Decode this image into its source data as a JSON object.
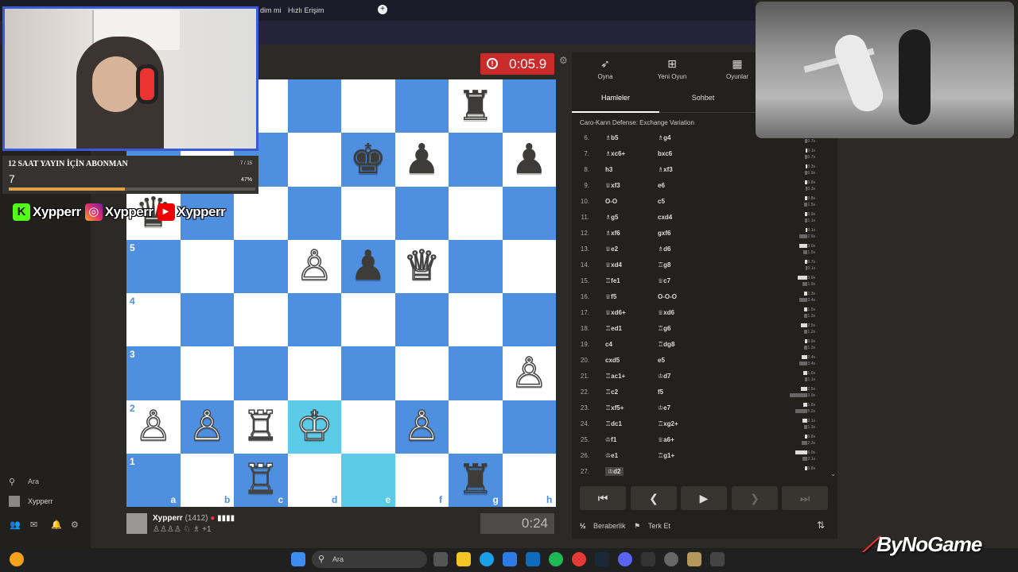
{
  "browser": {
    "tab1_label": "dim mi",
    "tab2_label": "Hızlı Erişim",
    "newtab_label": "+"
  },
  "overlay": {
    "goal_title": "12 SAAT YAYIN İÇİN ABONMAN",
    "goal_count": "7 / 15",
    "goal_current": "7",
    "goal_percent_label": "47%",
    "goal_fraction": 0.47,
    "social_kick": "Xypperr",
    "social_instagram": "Xypperr",
    "social_youtube": "Xypperr",
    "brand": "ByNoGame"
  },
  "game": {
    "top_clock": "0:05.9",
    "bottom_clock": "0:24",
    "player_name": "Xypperr",
    "player_rating": "(1412)",
    "player_captured": "+1",
    "files": [
      "a",
      "b",
      "c",
      "d",
      "e",
      "f",
      "g",
      "h"
    ],
    "ranks_shown": [
      "5",
      "4",
      "3",
      "2",
      "1"
    ],
    "pieces": [
      {
        "sq": "g8",
        "p": "♜",
        "c": "b"
      },
      {
        "sq": "e7",
        "p": "♚",
        "c": "b"
      },
      {
        "sq": "f7",
        "p": "♟",
        "c": "b"
      },
      {
        "sq": "h7",
        "p": "♟",
        "c": "b"
      },
      {
        "sq": "a6",
        "p": "♛",
        "c": "b"
      },
      {
        "sq": "d5",
        "p": "♙",
        "c": "w"
      },
      {
        "sq": "e5",
        "p": "♟",
        "c": "b"
      },
      {
        "sq": "f5",
        "p": "♕",
        "c": "w"
      },
      {
        "sq": "h3",
        "p": "♙",
        "c": "w"
      },
      {
        "sq": "a2",
        "p": "♙",
        "c": "w"
      },
      {
        "sq": "b2",
        "p": "♙",
        "c": "w"
      },
      {
        "sq": "c2",
        "p": "♖",
        "c": "w"
      },
      {
        "sq": "d2",
        "p": "♔",
        "c": "w"
      },
      {
        "sq": "f2",
        "p": "♙",
        "c": "w"
      },
      {
        "sq": "c1",
        "p": "♖",
        "c": "w"
      },
      {
        "sq": "g1",
        "p": "♜",
        "c": "b"
      }
    ],
    "highlight_squares": [
      "d2",
      "e1"
    ]
  },
  "panel": {
    "btn_play": "Oyna",
    "btn_new_game": "Yeni Oyun",
    "btn_games": "Oyunlar",
    "tab_moves": "Hamleler",
    "tab_chat": "Sohbet",
    "opening": "Caro-Kann Defense: Exchange Variation",
    "moves": [
      {
        "n": "6.",
        "w": "♗b5",
        "b": "♗g4",
        "tw": "0.7s",
        "tb": "0.7s",
        "vw": 3,
        "vb": 3
      },
      {
        "n": "7.",
        "w": "♗xc6+",
        "b": "bxc6",
        "tw": "0.1s",
        "tb": "0.7s",
        "vw": 2,
        "vb": 3
      },
      {
        "n": "8.",
        "w": "h3",
        "b": "♗xf3",
        "tw": "0.3s",
        "tb": "0.9s",
        "vw": 2,
        "vb": 3
      },
      {
        "n": "9.",
        "w": "♕xf3",
        "b": "e6",
        "tw": "0.8s",
        "tb": "0.3s",
        "vw": 3,
        "vb": 2
      },
      {
        "n": "10.",
        "w": "O-O",
        "b": "c5",
        "tw": "0.8s",
        "tb": "1.5s",
        "vw": 3,
        "vb": 4
      },
      {
        "n": "11.",
        "w": "♗g5",
        "b": "cxd4",
        "tw": "0.9s",
        "tb": "1.1s",
        "vw": 3,
        "vb": 3
      },
      {
        "n": "12.",
        "w": "♗xf6",
        "b": "gxf6",
        "tw": "0.1s",
        "tb": "2.6s",
        "vw": 2,
        "vb": 10
      },
      {
        "n": "13.",
        "w": "♕e2",
        "b": "♗d6",
        "tw": "3.0s",
        "tb": "1.5s",
        "vw": 10,
        "vb": 5
      },
      {
        "n": "14.",
        "w": "♕xd4",
        "b": "♖g8",
        "tw": "0.7s",
        "tb": "0.1s",
        "vw": 3,
        "vb": 2
      },
      {
        "n": "15.",
        "w": "♖fe1",
        "b": "♕c7",
        "tw": "3.9s",
        "tb": "1.9s",
        "vw": 12,
        "vb": 6
      },
      {
        "n": "16.",
        "w": "♕f5",
        "b": "O-O-O",
        "tw": "1.3s",
        "tb": "3.4s",
        "vw": 4,
        "vb": 10
      },
      {
        "n": "17.",
        "w": "♕xd6+",
        "b": "♕xd6",
        "tw": "1.5s",
        "tb": "1.3s",
        "vw": 4,
        "vb": 4
      },
      {
        "n": "18.",
        "w": "♖ed1",
        "b": "♖g6",
        "tw": "2.5s",
        "tb": "1.2s",
        "vw": 8,
        "vb": 4
      },
      {
        "n": "19.",
        "w": "c4",
        "b": "♖dg8",
        "tw": "0.9s",
        "tb": "1.3s",
        "vw": 3,
        "vb": 4
      },
      {
        "n": "20.",
        "w": "cxd5",
        "b": "e5",
        "tw": "2.4s",
        "tb": "3.4s",
        "vw": 7,
        "vb": 10
      },
      {
        "n": "21.",
        "w": "♖ac1+",
        "b": "♔d7",
        "tw": "1.6s",
        "tb": "1.1s",
        "vw": 5,
        "vb": 3
      },
      {
        "n": "22.",
        "w": "♖c2",
        "b": "f5",
        "tw": "2.5s",
        "tb": "13.9s",
        "vw": 8,
        "vb": 22
      },
      {
        "n": "23.",
        "w": "♖xf5+",
        "b": "♔e7",
        "tw": "1.8s",
        "tb": "5.2s",
        "vw": 5,
        "vb": 15
      },
      {
        "n": "24.",
        "w": "♖dc1",
        "b": "♖xg2+",
        "tw": "2.1s",
        "tb": "1.3s",
        "vw": 6,
        "vb": 4
      },
      {
        "n": "25.",
        "w": "♔f1",
        "b": "♕a6+",
        "tw": "0.8s",
        "tb": "2.3s",
        "vw": 3,
        "vb": 7
      },
      {
        "n": "26.",
        "w": "♔e1",
        "b": "♖g1+",
        "tw": "6.0s",
        "tb": "2.1s",
        "vw": 15,
        "vb": 6
      },
      {
        "n": "27.",
        "w": "♔d2",
        "b": "",
        "tw": "0.8s",
        "tb": "",
        "vw": 3,
        "vb": 0
      }
    ],
    "nav_first": "⏮",
    "nav_prev": "❮",
    "nav_play": "▶",
    "nav_next": "❯",
    "nav_last": "⏭",
    "action_draw": "Beraberlik",
    "action_resign": "Terk Et",
    "draw_icon": "½"
  },
  "sidebar": {
    "search_label": "Ara",
    "user_label": "Xypperr"
  },
  "taskbar": {
    "search_placeholder": "Ara"
  },
  "colors": {
    "board_dark": "#4e8fe0",
    "board_light": "#ffffff",
    "highlight": "#5ccbe8",
    "clock_red": "#c92a2a"
  }
}
